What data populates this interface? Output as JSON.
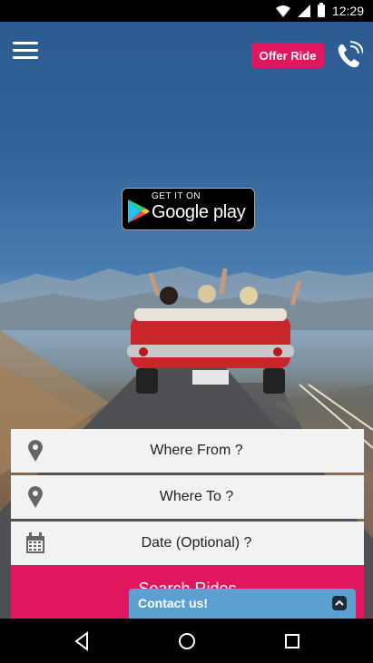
{
  "status_bar": {
    "time": "12:29",
    "icons": [
      "wifi-icon",
      "signal-icon",
      "battery-icon"
    ]
  },
  "header": {
    "menu_icon": "hamburger-menu-icon",
    "offer_ride_label": "Offer Ride",
    "call_icon": "phone-call-icon"
  },
  "badge": {
    "line1": "GET IT ON",
    "line2": "Google play"
  },
  "form": {
    "from_label": "Where From ?",
    "to_label": "Where To ?",
    "date_label": "Date (Optional) ?",
    "search_label": "Search Rides"
  },
  "contact": {
    "label": "Contact us!",
    "toggle_icon": "chevron-up-icon"
  },
  "colors": {
    "accent": "#e0175f",
    "contact_bar": "#5aa0d0"
  },
  "nav": {
    "icons": [
      "back-icon",
      "home-icon",
      "recents-icon"
    ]
  }
}
